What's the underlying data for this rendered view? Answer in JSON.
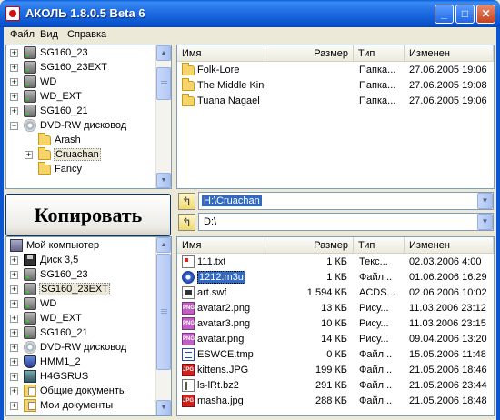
{
  "window": {
    "title": "АКОЛЬ 1.8.0.5 Beta 6",
    "min": "_",
    "max": "□",
    "close": "✕"
  },
  "menu": [
    "Файл",
    "Вид",
    "Справка"
  ],
  "top_tree": {
    "items": [
      {
        "label": "SG160_23",
        "icon": "drive-icon",
        "expander": "+"
      },
      {
        "label": "SG160_23EXT",
        "icon": "drive-icon",
        "expander": "+"
      },
      {
        "label": "WD",
        "icon": "drive-icon",
        "expander": "+"
      },
      {
        "label": "WD_EXT",
        "icon": "drive-icon",
        "expander": "+"
      },
      {
        "label": "SG160_21",
        "icon": "drive-icon",
        "expander": "+"
      },
      {
        "label": "DVD-RW дисковод",
        "icon": "cd-icon",
        "expander": "−"
      },
      {
        "label": "Arash",
        "icon": "folder-icon",
        "expander": ""
      },
      {
        "label": "Cruachan",
        "icon": "folder-icon",
        "expander": "+",
        "selected": true
      },
      {
        "label": "Fancy",
        "icon": "folder-icon",
        "expander": ""
      }
    ]
  },
  "top_list": {
    "columns": [
      "Имя",
      "Размер",
      "Тип",
      "Изменен"
    ],
    "rows": [
      {
        "name": "Folk-Lore",
        "size": "",
        "type": "Папка...",
        "modified": "27.06.2005 19:06"
      },
      {
        "name": "The Middle Kingdom",
        "size": "",
        "type": "Папка...",
        "modified": "27.06.2005 19:08"
      },
      {
        "name": "Tuana Nagael",
        "size": "",
        "type": "Папка...",
        "modified": "27.06.2005 19:06"
      }
    ]
  },
  "copy_button": "Копировать",
  "source_path": "H:\\Cruachan",
  "dest_path": "D:\\",
  "bottom_tree": {
    "items": [
      {
        "label": "Мой компьютер",
        "icon": "computer-icon",
        "expander": ""
      },
      {
        "label": "Диск 3,5",
        "icon": "floppy-icon",
        "expander": "+"
      },
      {
        "label": "SG160_23",
        "icon": "drive-icon",
        "expander": "+"
      },
      {
        "label": "SG160_23EXT",
        "icon": "drive-icon",
        "expander": "+",
        "selected": true
      },
      {
        "label": "WD",
        "icon": "drive-icon",
        "expander": "+"
      },
      {
        "label": "WD_EXT",
        "icon": "drive-icon",
        "expander": "+"
      },
      {
        "label": "SG160_21",
        "icon": "drive-icon",
        "expander": "+"
      },
      {
        "label": "DVD-RW дисковод",
        "icon": "cd-icon",
        "expander": "+"
      },
      {
        "label": "HMM1_2",
        "icon": "shield-icon",
        "expander": "+"
      },
      {
        "label": "H4GSRUS",
        "icon": "network-drive-icon",
        "expander": "+"
      },
      {
        "label": "Общие документы",
        "icon": "shared-docs-icon",
        "expander": "+"
      },
      {
        "label": "Мои документы",
        "icon": "shared-docs-icon",
        "expander": "+"
      }
    ]
  },
  "bottom_list": {
    "columns": [
      "Имя",
      "Размер",
      "Тип",
      "Изменен"
    ],
    "rows": [
      {
        "name": "111.txt",
        "size": "1 КБ",
        "type": "Текс...",
        "modified": "02.03.2006 4:00",
        "icon": "txt"
      },
      {
        "name": "1212.m3u",
        "size": "1 КБ",
        "type": "Файл...",
        "modified": "01.06.2006 16:29",
        "icon": "m3u",
        "selected": true
      },
      {
        "name": "art.swf",
        "size": "1 594 КБ",
        "type": "ACDS...",
        "modified": "02.06.2006 10:02",
        "icon": "swf"
      },
      {
        "name": "avatar2.png",
        "size": "13 КБ",
        "type": "Рису...",
        "modified": "11.03.2006 23:12",
        "icon": "png"
      },
      {
        "name": "avatar3.png",
        "size": "10 КБ",
        "type": "Рису...",
        "modified": "11.03.2006 23:15",
        "icon": "png"
      },
      {
        "name": "avatar.png",
        "size": "14 КБ",
        "type": "Рису...",
        "modified": "09.04.2006 13:20",
        "icon": "png"
      },
      {
        "name": "ESWCE.tmp",
        "size": "0 КБ",
        "type": "Файл...",
        "modified": "15.05.2006 11:48",
        "icon": "tmp"
      },
      {
        "name": "kittens.JPG",
        "size": "199 КБ",
        "type": "Файл...",
        "modified": "21.05.2006 18:46",
        "icon": "jpg"
      },
      {
        "name": "ls-lRt.bz2",
        "size": "291 КБ",
        "type": "Файл...",
        "modified": "21.05.2006 23:44",
        "icon": "bz2"
      },
      {
        "name": "masha.jpg",
        "size": "288 КБ",
        "type": "Файл...",
        "modified": "21.05.2006 18:48",
        "icon": "jpg"
      }
    ]
  },
  "icon_text": {
    "png": "PNG",
    "jpg": "JPG"
  },
  "colors": {
    "title_bar": "#0a55d0",
    "selection": "#316ac5",
    "chrome": "#ece9d8"
  }
}
